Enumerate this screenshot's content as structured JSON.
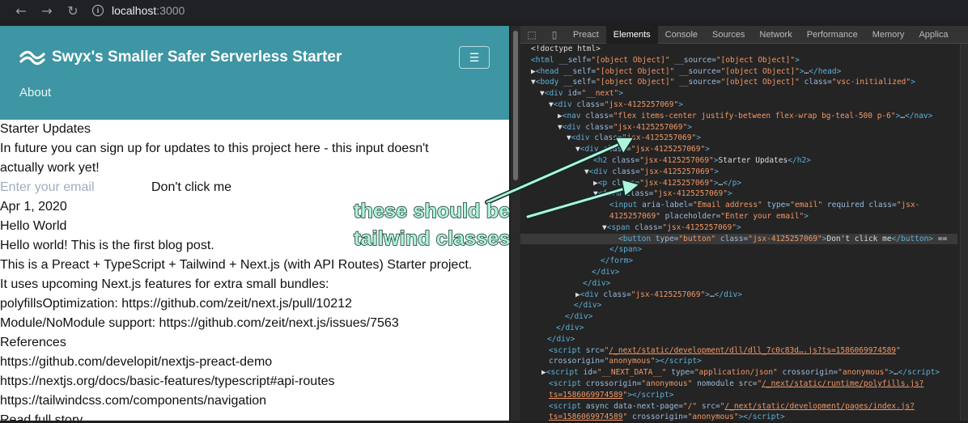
{
  "browser": {
    "back_glyph": "←",
    "forward_glyph": "→",
    "reload_glyph": "↻",
    "url_host": "localhost",
    "url_port": ":3000"
  },
  "site": {
    "brand": "Swyx's Smaller Safer Serverless Starter",
    "menu_glyph": "☰",
    "nav_link": "About",
    "lines": [
      "Starter Updates",
      "In future you can sign up for updates to this project here - this input doesn't",
      "actually work yet!"
    ],
    "email_placeholder": "Enter your email",
    "button_label": "Don't click me",
    "post_lines": [
      "Apr 1, 2020",
      "Hello World",
      "Hello world! This is the first blog post.",
      "This is a Preact + TypeScript + Tailwind + Next.js (with API Routes) Starter project.",
      "It uses upcoming Next.js features for extra small bundles:",
      "polyfillsOptimization: https://github.com/zeit/next.js/pull/10212",
      "Module/NoModule support: https://github.com/zeit/next.js/issues/7563",
      "References",
      "https://github.com/developit/nextjs-preact-demo",
      "https://nextjs.org/docs/basic-features/typescript#api-routes",
      "https://tailwindcss.com/components/navigation",
      "Read full story"
    ]
  },
  "devtools": {
    "tabs": [
      "Preact",
      "Elements",
      "Console",
      "Sources",
      "Network",
      "Performance",
      "Memory",
      "Applica"
    ],
    "active_tab": "Elements"
  },
  "annotation": {
    "line1": "these should be",
    "line2": "tailwind classes"
  },
  "colors": {
    "teal": "#3e95a3",
    "annotation": "#aef3dd"
  }
}
